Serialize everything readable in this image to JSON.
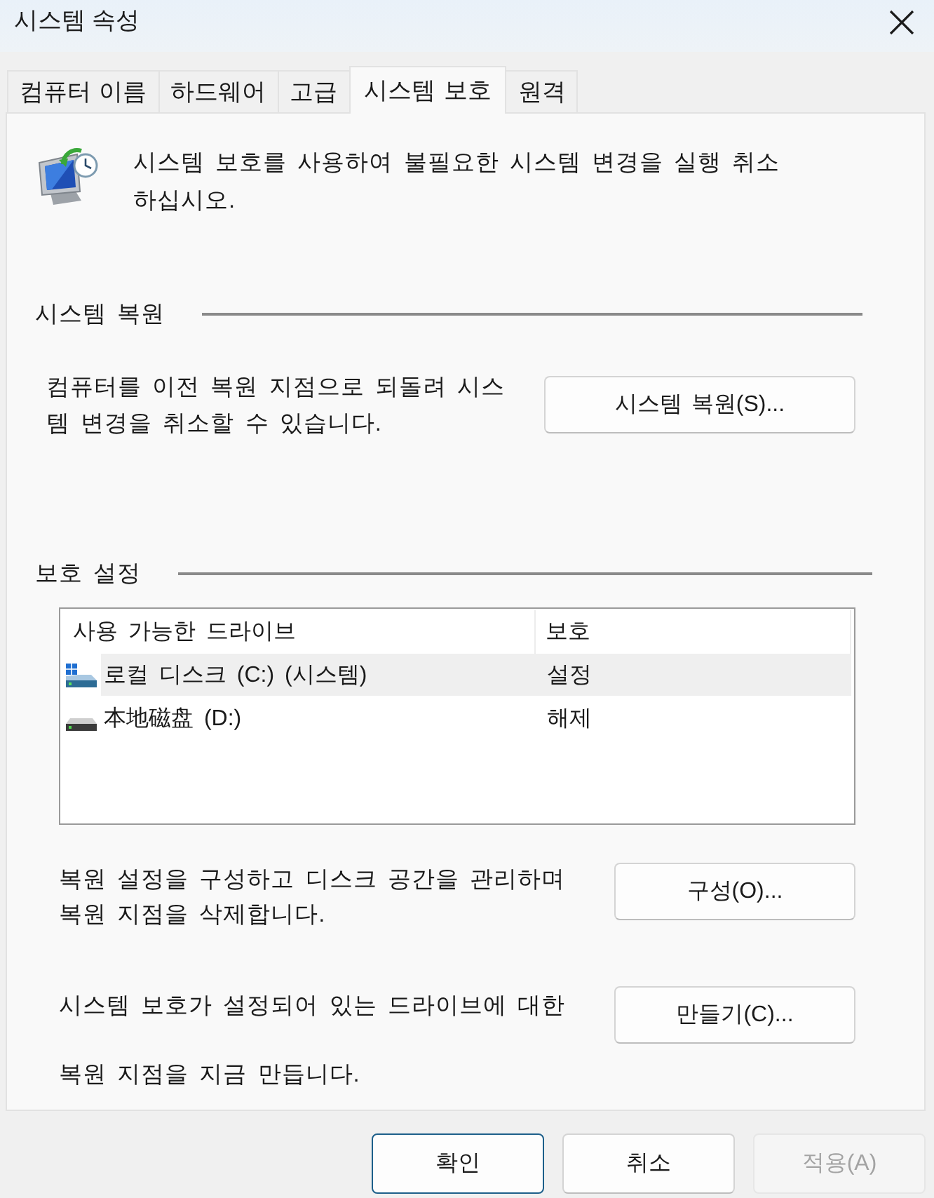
{
  "window": {
    "title": "시스템 속성"
  },
  "tabs": [
    {
      "label": "컴퓨터 이름",
      "selected": false
    },
    {
      "label": "하드웨어",
      "selected": false
    },
    {
      "label": "고급",
      "selected": false
    },
    {
      "label": "시스템 보호",
      "selected": true
    },
    {
      "label": "원격",
      "selected": false
    }
  ],
  "intro": {
    "lines": [
      "시스템 보호를 사용하여 불필요한 시스템 변경을 실행 취소",
      "하십시오."
    ]
  },
  "system_restore": {
    "heading": "시스템 복원",
    "description": {
      "lines": [
        "컴퓨터를 이전 복원 지점으로 되돌려 시스",
        "템 변경을 취소할 수 있습니다."
      ]
    },
    "button": "시스템 복원(S)..."
  },
  "protection_settings": {
    "heading": "보호 설정",
    "drives": {
      "columns": [
        "사용 가능한 드라이브",
        "보호"
      ],
      "rows": [
        {
          "kind": "system",
          "name": "로컬 디스크 (C:) (시스템)",
          "protection": "설정",
          "selected": true
        },
        {
          "kind": "local",
          "name": "本地磁盘 (D:)",
          "protection": "해제",
          "selected": false
        }
      ]
    },
    "configure": {
      "description": {
        "lines": [
          "복원 설정을 구성하고 디스크 공간을 관리하며",
          "복원 지점을 삭제합니다."
        ]
      },
      "button": "구성(O)..."
    },
    "create": {
      "description": {
        "lines": [
          "시스템 보호가 설정되어 있는 드라이브에 대한",
          "복원 지점을 지금 만듭니다."
        ]
      },
      "button": "만들기(C)..."
    }
  },
  "buttons": [
    {
      "label": "확인",
      "default": true,
      "disabled": false
    },
    {
      "label": "취소",
      "default": false,
      "disabled": false
    },
    {
      "label": "적용(A)",
      "default": false,
      "disabled": true
    }
  ]
}
